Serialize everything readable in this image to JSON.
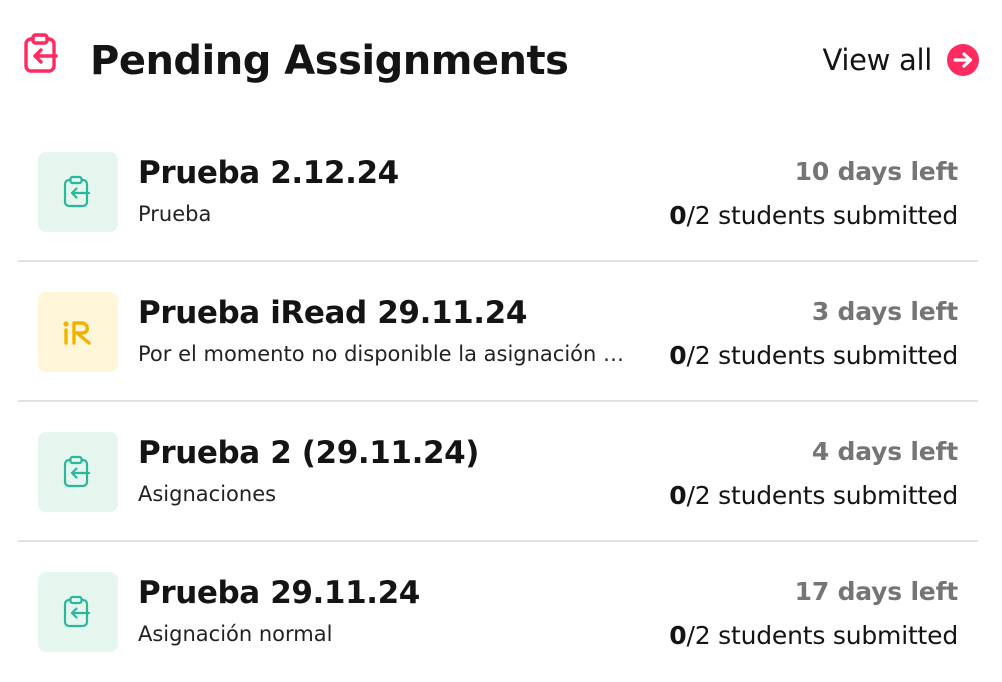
{
  "header": {
    "title": "Pending Assignments",
    "view_all_label": "View all",
    "icon": "clipboard-return-icon",
    "accent_color": "#ff2a5f"
  },
  "assignments": [
    {
      "title": "Prueba 2.12.24",
      "subtitle": "Prueba",
      "days_left": "10 days left",
      "submitted_count": "0",
      "submitted_total": "/2 students submitted",
      "icon": "clipboard-return-icon",
      "thumb_color": "#e4f6ee"
    },
    {
      "title": "Prueba iRead 29.11.24",
      "subtitle": "Por el momento no disponible la asignación de niveles",
      "days_left": "3 days left",
      "submitted_count": "0",
      "submitted_total": "/2 students submitted",
      "icon": "iread-logo-icon",
      "thumb_color": "#fff6da"
    },
    {
      "title": "Prueba 2 (29.11.24)",
      "subtitle": "Asignaciones",
      "days_left": "4 days left",
      "submitted_count": "0",
      "submitted_total": "/2 students submitted",
      "icon": "clipboard-return-icon",
      "thumb_color": "#e4f6ee"
    },
    {
      "title": "Prueba 29.11.24",
      "subtitle": "Asignación normal",
      "days_left": "17 days left",
      "submitted_count": "0",
      "submitted_total": "/2 students submitted",
      "icon": "clipboard-return-icon",
      "thumb_color": "#e4f6ee"
    }
  ]
}
